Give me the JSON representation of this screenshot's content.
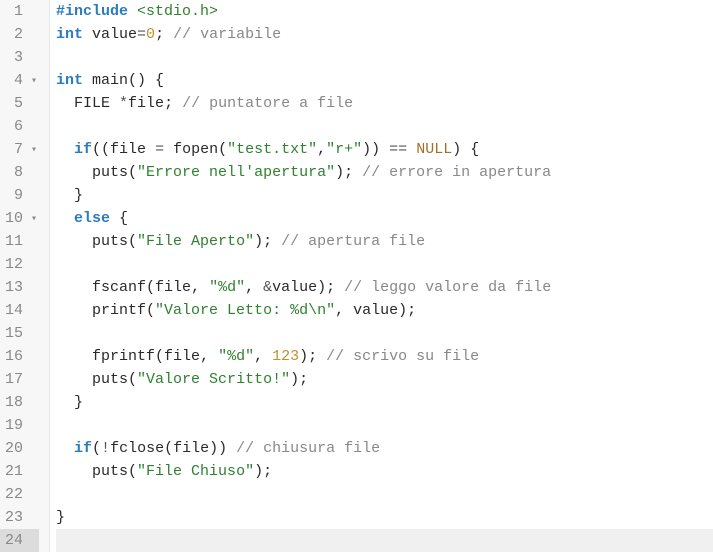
{
  "lines": [
    {
      "n": 1,
      "fold": false,
      "tokens": [
        [
          "pre",
          "#include "
        ],
        [
          "inc",
          "<stdio.h>"
        ]
      ]
    },
    {
      "n": 2,
      "fold": false,
      "tokens": [
        [
          "kw",
          "int "
        ],
        [
          "id",
          "value"
        ],
        [
          "op",
          "="
        ],
        [
          "num",
          "0"
        ],
        [
          "pun",
          "; "
        ],
        [
          "cmt",
          "// variabile"
        ]
      ]
    },
    {
      "n": 3,
      "fold": false,
      "tokens": []
    },
    {
      "n": 4,
      "fold": true,
      "tokens": [
        [
          "kw",
          "int "
        ],
        [
          "fn",
          "main"
        ],
        [
          "pun",
          "() {"
        ]
      ]
    },
    {
      "n": 5,
      "fold": false,
      "tokens": [
        [
          "pun",
          "  "
        ],
        [
          "id",
          "FILE "
        ],
        [
          "op",
          "*"
        ],
        [
          "id",
          "file"
        ],
        [
          "pun",
          "; "
        ],
        [
          "cmt",
          "// puntatore a file"
        ]
      ]
    },
    {
      "n": 6,
      "fold": false,
      "tokens": []
    },
    {
      "n": 7,
      "fold": true,
      "tokens": [
        [
          "pun",
          "  "
        ],
        [
          "kw",
          "if"
        ],
        [
          "pun",
          "(("
        ],
        [
          "id",
          "file "
        ],
        [
          "op",
          "= "
        ],
        [
          "fn",
          "fopen"
        ],
        [
          "pun",
          "("
        ],
        [
          "str",
          "\"test.txt\""
        ],
        [
          "pun",
          ","
        ],
        [
          "str",
          "\"r+\""
        ],
        [
          "pun",
          ")) "
        ],
        [
          "op",
          "== "
        ],
        [
          "null",
          "NULL"
        ],
        [
          "pun",
          ") {"
        ]
      ]
    },
    {
      "n": 8,
      "fold": false,
      "tokens": [
        [
          "pun",
          "    "
        ],
        [
          "fn",
          "puts"
        ],
        [
          "pun",
          "("
        ],
        [
          "str",
          "\"Errore nell'apertura\""
        ],
        [
          "pun",
          "); "
        ],
        [
          "cmt",
          "// errore in apertura"
        ]
      ]
    },
    {
      "n": 9,
      "fold": false,
      "tokens": [
        [
          "pun",
          "  }"
        ]
      ]
    },
    {
      "n": 10,
      "fold": true,
      "tokens": [
        [
          "pun",
          "  "
        ],
        [
          "kw",
          "else"
        ],
        [
          "pun",
          " {"
        ]
      ]
    },
    {
      "n": 11,
      "fold": false,
      "tokens": [
        [
          "pun",
          "    "
        ],
        [
          "fn",
          "puts"
        ],
        [
          "pun",
          "("
        ],
        [
          "str",
          "\"File Aperto\""
        ],
        [
          "pun",
          "); "
        ],
        [
          "cmt",
          "// apertura file"
        ]
      ]
    },
    {
      "n": 12,
      "fold": false,
      "tokens": []
    },
    {
      "n": 13,
      "fold": false,
      "tokens": [
        [
          "pun",
          "    "
        ],
        [
          "fn",
          "fscanf"
        ],
        [
          "pun",
          "("
        ],
        [
          "id",
          "file"
        ],
        [
          "pun",
          ", "
        ],
        [
          "str",
          "\"%d\""
        ],
        [
          "pun",
          ", "
        ],
        [
          "op",
          "&"
        ],
        [
          "id",
          "value"
        ],
        [
          "pun",
          "); "
        ],
        [
          "cmt",
          "// leggo valore da file"
        ]
      ]
    },
    {
      "n": 14,
      "fold": false,
      "tokens": [
        [
          "pun",
          "    "
        ],
        [
          "fn",
          "printf"
        ],
        [
          "pun",
          "("
        ],
        [
          "str",
          "\"Valore Letto: %d\\n\""
        ],
        [
          "pun",
          ", "
        ],
        [
          "id",
          "value"
        ],
        [
          "pun",
          ");"
        ]
      ]
    },
    {
      "n": 15,
      "fold": false,
      "tokens": []
    },
    {
      "n": 16,
      "fold": false,
      "tokens": [
        [
          "pun",
          "    "
        ],
        [
          "fn",
          "fprintf"
        ],
        [
          "pun",
          "("
        ],
        [
          "id",
          "file"
        ],
        [
          "pun",
          ", "
        ],
        [
          "str",
          "\"%d\""
        ],
        [
          "pun",
          ", "
        ],
        [
          "num",
          "123"
        ],
        [
          "pun",
          "); "
        ],
        [
          "cmt",
          "// scrivo su file"
        ]
      ]
    },
    {
      "n": 17,
      "fold": false,
      "tokens": [
        [
          "pun",
          "    "
        ],
        [
          "fn",
          "puts"
        ],
        [
          "pun",
          "("
        ],
        [
          "str",
          "\"Valore Scritto!\""
        ],
        [
          "pun",
          ");"
        ]
      ]
    },
    {
      "n": 18,
      "fold": false,
      "tokens": [
        [
          "pun",
          "  }"
        ]
      ]
    },
    {
      "n": 19,
      "fold": false,
      "tokens": []
    },
    {
      "n": 20,
      "fold": false,
      "tokens": [
        [
          "pun",
          "  "
        ],
        [
          "kw",
          "if"
        ],
        [
          "pun",
          "("
        ],
        [
          "op",
          "!"
        ],
        [
          "fn",
          "fclose"
        ],
        [
          "pun",
          "("
        ],
        [
          "id",
          "file"
        ],
        [
          "pun",
          ")) "
        ],
        [
          "cmt",
          "// chiusura file"
        ]
      ]
    },
    {
      "n": 21,
      "fold": false,
      "tokens": [
        [
          "pun",
          "    "
        ],
        [
          "fn",
          "puts"
        ],
        [
          "pun",
          "("
        ],
        [
          "str",
          "\"File Chiuso\""
        ],
        [
          "pun",
          ");"
        ]
      ]
    },
    {
      "n": 22,
      "fold": false,
      "tokens": []
    },
    {
      "n": 23,
      "fold": false,
      "tokens": [
        [
          "pun",
          "}"
        ]
      ]
    },
    {
      "n": 24,
      "fold": false,
      "active": true,
      "tokens": []
    }
  ],
  "fold_glyph": "▾"
}
